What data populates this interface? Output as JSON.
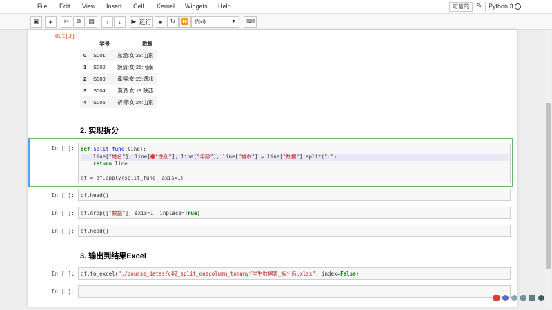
{
  "menubar": {
    "items": [
      "File",
      "Edit",
      "View",
      "Insert",
      "Cell",
      "Kernel",
      "Widgets",
      "Help"
    ],
    "trusted": "可信的",
    "kernel": "Python 3"
  },
  "toolbar": {
    "run_label": "运行",
    "cell_type": "代码"
  },
  "output": {
    "prompt": "Out[3]:",
    "columns": [
      "学号",
      "数据"
    ],
    "rows": [
      {
        "index": "0",
        "id": "S001",
        "data": "怠涵:女:23:山东"
      },
      {
        "index": "1",
        "id": "S002",
        "data": "婉清:女:25:河南"
      },
      {
        "index": "2",
        "id": "S003",
        "data": "溪榕:女:23:湖北"
      },
      {
        "index": "3",
        "id": "S004",
        "data": "漠涓:女:19:陕西"
      },
      {
        "index": "4",
        "id": "S005",
        "data": "祈博:女:24:山东"
      }
    ]
  },
  "heading2": "2. 实现拆分",
  "heading3": "3. 输出到结果Excel",
  "prompt_empty": "In [ ]:",
  "cells": {
    "c1_l1_a": "def ",
    "c1_l1_b": "split_func",
    "c1_l1_c": "(line):",
    "c1_l2_a": "    line[",
    "c1_l2_s1": "\"姓名\"",
    "c1_l2_b": "], line[",
    "c1_l2_s2": "\"性别\"",
    "c1_l2_c": "], line[",
    "c1_l2_s3": "\"年龄\"",
    "c1_l2_d": "], line[",
    "c1_l2_s4": "\"城市\"",
    "c1_l2_e": "] = line[",
    "c1_l2_s5": "\"数据\"",
    "c1_l2_f": "].split(",
    "c1_l2_s6": "\":\"",
    "c1_l2_g": ")",
    "c1_l3_a": "    ",
    "c1_l3_kw": "return",
    "c1_l3_b": " line",
    "c1_l5": "df = df.apply(split_func, axis=1)",
    "c2": "df.head()",
    "c3_a": "df.drop([",
    "c3_s": "\"数据\"",
    "c3_b": "], axis=1, inplace=",
    "c3_kw": "True",
    "c3_c": ")",
    "c4": "df.head()",
    "c5_a": "df.to_excel(",
    "c5_s": "\"./course_datas/c42_split_onecolumn_tomany/学生数据表_拆分后.xlsx\"",
    "c5_b": ", index=",
    "c5_kw": "False",
    "c5_c": ")"
  }
}
